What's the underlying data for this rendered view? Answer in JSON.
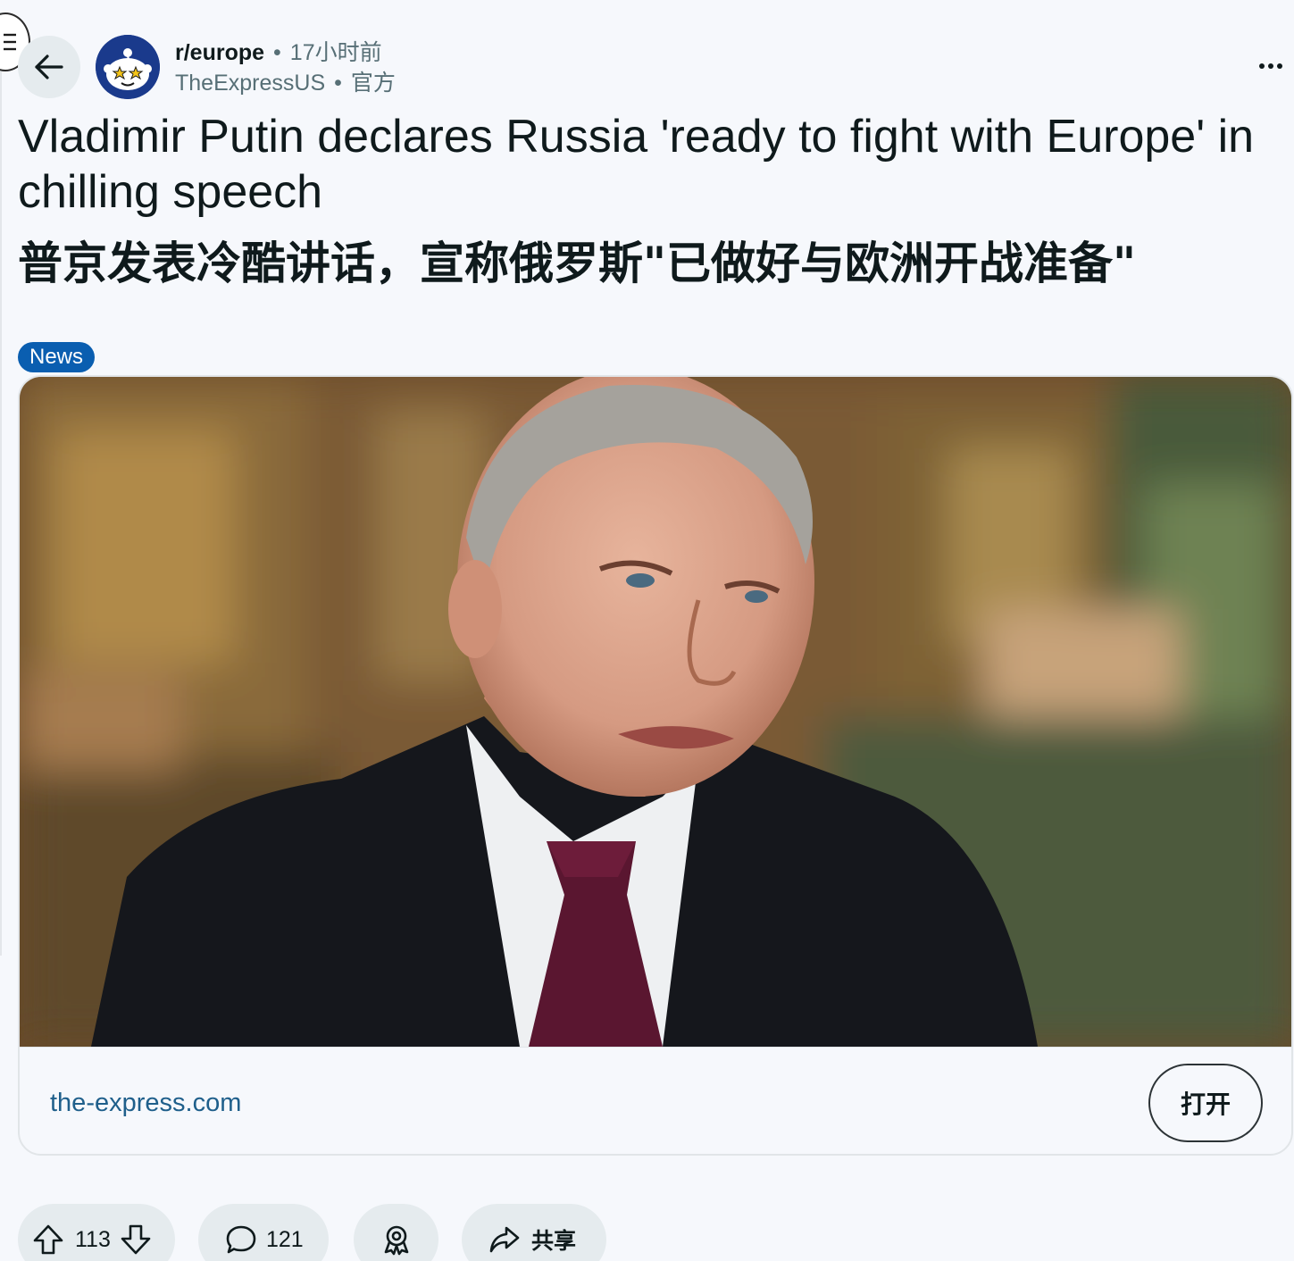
{
  "header": {
    "subreddit": "r/europe",
    "separator": "•",
    "time_ago": "17小时前",
    "author": "TheExpressUS",
    "author_badge": "官方"
  },
  "post": {
    "title_en": "Vladimir Putin declares Russia 'ready to fight with Europe' in chilling speech",
    "title_zh": "普京发表冷酷讲话，宣称俄罗斯\"已做好与欧洲开战准备\"",
    "flair": "News",
    "flair_color": "#0a5eb0"
  },
  "link_card": {
    "domain": "the-express.com",
    "open_label": "打开"
  },
  "actions": {
    "upvotes": "113",
    "comments": "121",
    "share_label": "共享"
  },
  "icons": {
    "menu": "menu-icon",
    "back": "arrow-left-icon",
    "more": "more-horizontal-icon",
    "upvote": "arrow-up-icon",
    "downvote": "arrow-down-icon",
    "comment": "comment-bubble-icon",
    "award": "award-icon",
    "share": "share-arrow-icon"
  }
}
